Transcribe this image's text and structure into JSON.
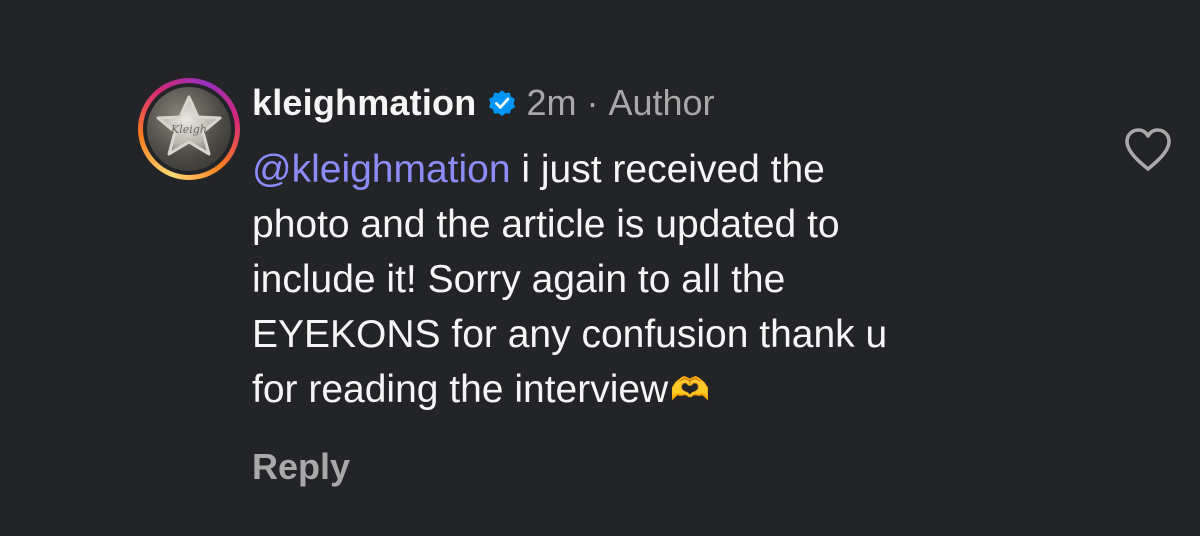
{
  "comment": {
    "username": "kleighmation",
    "time": "2m",
    "separator": "·",
    "role": "Author",
    "mention": "@kleighmation",
    "text_line1": " i just received the",
    "text_line2": "photo and the article is updated to",
    "text_line3": "include it! Sorry again to all the",
    "text_line4": "EYEKONS for any confusion thank u",
    "text_line5": "for reading the interview",
    "emoji": "🫶",
    "reply_label": "Reply",
    "avatar_logo_text": "Kleigh"
  },
  "icons": {
    "verified": "verified-badge-icon",
    "like": "heart-outline-icon"
  },
  "colors": {
    "background": "#232428",
    "text": "#f5f5f5",
    "muted": "#a8a8a8",
    "mention": "#8c8cf8",
    "verified": "#0095f6"
  }
}
